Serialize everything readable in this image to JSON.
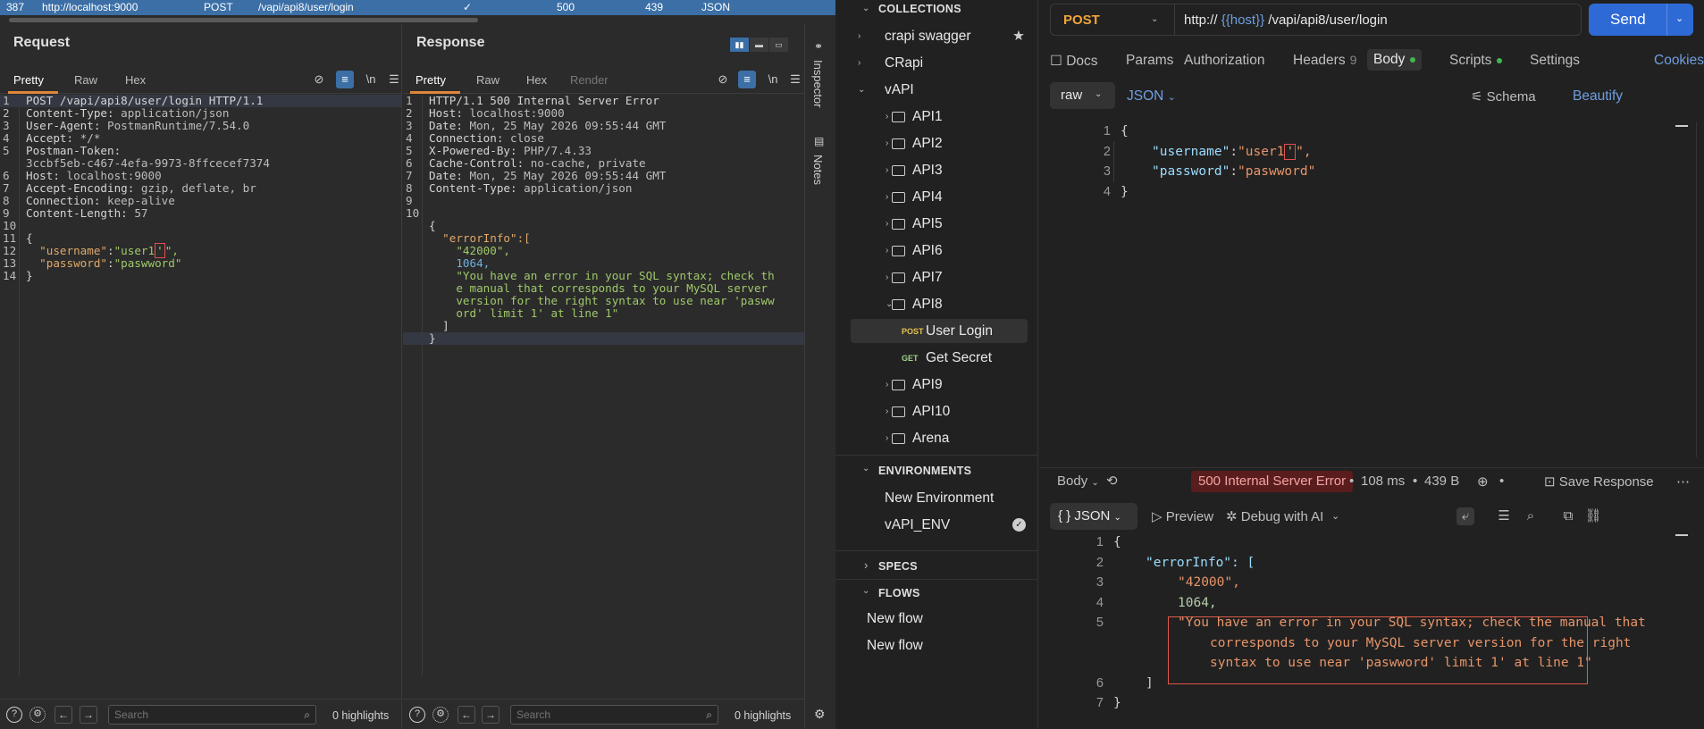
{
  "burp": {
    "row": {
      "id": "387",
      "host": "http://localhost:9000",
      "method": "POST",
      "path": "/vapi/api8/user/login",
      "check": "✓",
      "status": "500",
      "length": "439",
      "mime": "JSON"
    },
    "request": {
      "title": "Request",
      "tabs": [
        "Pretty",
        "Raw",
        "Hex"
      ],
      "lines": [
        {
          "n": "1",
          "text": "POST /vapi/api8/user/login HTTP/1.1"
        },
        {
          "n": "2",
          "key": "Content-Type: ",
          "val": "application/json"
        },
        {
          "n": "3",
          "key": "User-Agent: ",
          "val": "PostmanRuntime/7.54.0"
        },
        {
          "n": "4",
          "key": "Accept: ",
          "val": "*/*"
        },
        {
          "n": "5",
          "key": "Postman-Token: ",
          "val": ""
        },
        {
          "n": "",
          "key": "",
          "val": "3ccbf5eb-c467-4efa-9973-8ffcecef7374"
        },
        {
          "n": "6",
          "key": "Host: ",
          "val": "localhost:9000"
        },
        {
          "n": "7",
          "key": "Accept-Encoding: ",
          "val": "gzip, deflate, br"
        },
        {
          "n": "8",
          "key": "Connection: ",
          "val": "keep-alive"
        },
        {
          "n": "9",
          "key": "Content-Length: ",
          "val": "57"
        },
        {
          "n": "10",
          "text": ""
        },
        {
          "n": "11",
          "text": "{"
        },
        {
          "n": "12",
          "jkey": "\"username\"",
          "jval_pre": "\"user1",
          "jval_box": "'",
          "jval_post": "\","
        },
        {
          "n": "13",
          "jkey": "\"password\"",
          "jval_pre": "\"paswword\"",
          "jval_box": "",
          "jval_post": ""
        },
        {
          "n": "14",
          "text": "}"
        }
      ],
      "search_placeholder": "Search",
      "highlights": "0 highlights"
    },
    "response": {
      "title": "Response",
      "tabs": [
        "Pretty",
        "Raw",
        "Hex",
        "Render"
      ],
      "lines": [
        {
          "n": "1",
          "text": "HTTP/1.1 500 Internal Server Error"
        },
        {
          "n": "2",
          "key": "Host: ",
          "val": "localhost:9000"
        },
        {
          "n": "3",
          "key": "Date: ",
          "val": "Mon, 25 May 2026 09:55:44 GMT"
        },
        {
          "n": "4",
          "key": "Connection: ",
          "val": "close"
        },
        {
          "n": "5",
          "key": "X-Powered-By: ",
          "val": "PHP/7.4.33"
        },
        {
          "n": "6",
          "key": "Cache-Control: ",
          "val": "no-cache, private"
        },
        {
          "n": "7",
          "key": "Date: ",
          "val": "Mon, 25 May 2026 09:55:44 GMT"
        },
        {
          "n": "8",
          "key": "Content-Type: ",
          "val": "application/json"
        },
        {
          "n": "9",
          "text": ""
        },
        {
          "n": "10",
          "text": ""
        },
        {
          "n": "",
          "text": "{"
        },
        {
          "n": "",
          "json": "  \"errorInfo\":[",
          "cls": "jkey"
        },
        {
          "n": "",
          "json": "    \"42000\",",
          "cls": "jstr"
        },
        {
          "n": "",
          "json": "    1064,",
          "cls": "jnum"
        },
        {
          "n": "",
          "json": "    \"You have an error in your SQL syntax; check th",
          "cls": "jstr"
        },
        {
          "n": "",
          "json": "    e manual that corresponds to your MySQL server",
          "cls": "jstr"
        },
        {
          "n": "",
          "json": "    version for the right syntax to use near 'pasww",
          "cls": "jstr"
        },
        {
          "n": "",
          "json": "    ord' limit 1' at line 1\"",
          "cls": "jstr"
        },
        {
          "n": "",
          "json": "  ]",
          "cls": "jpun"
        },
        {
          "n": "",
          "json": "}",
          "cls": "jpun"
        }
      ],
      "search_placeholder": "Search",
      "highlights": "0 highlights"
    },
    "side": {
      "inspector": "Inspector",
      "notes": "Notes"
    }
  },
  "postman": {
    "sidebar": {
      "collections_title": "COLLECTIONS",
      "collections": [
        {
          "label": "crapi swagger",
          "level": 0,
          "starred": true
        },
        {
          "label": "CRapi",
          "level": 0
        },
        {
          "label": "vAPI",
          "level": 0,
          "open": true
        }
      ],
      "vapi_folders_top": [
        "API1",
        "API2",
        "API3",
        "API4",
        "API5",
        "API6",
        "API7",
        "API8"
      ],
      "api8_requests": [
        {
          "method": "POST",
          "label": "User Login",
          "selected": true
        },
        {
          "method": "GET",
          "label": "Get Secret"
        }
      ],
      "vapi_folders_bottom": [
        "API9",
        "API10",
        "Arena"
      ],
      "environments_title": "ENVIRONMENTS",
      "environments": [
        "New Environment",
        "vAPI_ENV"
      ],
      "specs_title": "SPECS",
      "flows_title": "FLOWS",
      "flows": [
        "New flow",
        "New flow"
      ]
    },
    "request": {
      "method": "POST",
      "url_prefix": "http://",
      "url_var": "{{host}}",
      "url_path": "/vapi/api8/user/login",
      "send": "Send",
      "tabs": {
        "docs": "Docs",
        "params": "Params",
        "authorization": "Authorization",
        "headers": "Headers",
        "headers_count": "9",
        "body": "Body",
        "scripts": "Scripts",
        "settings": "Settings"
      },
      "cookies": "Cookies",
      "body_mode": "raw",
      "body_lang": "JSON",
      "schema": "Schema",
      "beautify": "Beautify",
      "body_lines": [
        "1",
        "2",
        "3",
        "4"
      ],
      "body_username_key": "\"username\"",
      "body_username_val_pre": "\"user1",
      "body_username_val_box": "'",
      "body_username_val_post": "\",",
      "body_password_key": "\"password\"",
      "body_password_val": "\"paswword\""
    },
    "response": {
      "body_label": "Body",
      "status": "500 Internal Server Error",
      "time": "108 ms",
      "size": "439 B",
      "save": "Save Response",
      "format": "JSON",
      "preview": "Preview",
      "debug": "Debug with AI",
      "lines": [
        {
          "n": "1",
          "text": "{",
          "cls": "pp",
          "indent": 0
        },
        {
          "n": "2",
          "text": "\"errorInfo\": [",
          "cls": "pk",
          "indent": 1
        },
        {
          "n": "3",
          "text": "\"42000\",",
          "cls": "ps",
          "indent": 2
        },
        {
          "n": "4",
          "text": "1064,",
          "cls": "pn",
          "indent": 2
        },
        {
          "n": "5",
          "text": "\"You have an error in your SQL syntax; check the manual that",
          "cls": "ps",
          "indent": 2
        },
        {
          "n": "",
          "text": "corresponds to your MySQL server version for the right",
          "cls": "ps",
          "indent": 3
        },
        {
          "n": "",
          "text": "syntax to use near 'paswword' limit 1' at line 1\"",
          "cls": "ps",
          "indent": 3
        },
        {
          "n": "6",
          "text": "]",
          "cls": "pp",
          "indent": 1
        },
        {
          "n": "7",
          "text": "}",
          "cls": "pp",
          "indent": 0
        }
      ]
    }
  }
}
